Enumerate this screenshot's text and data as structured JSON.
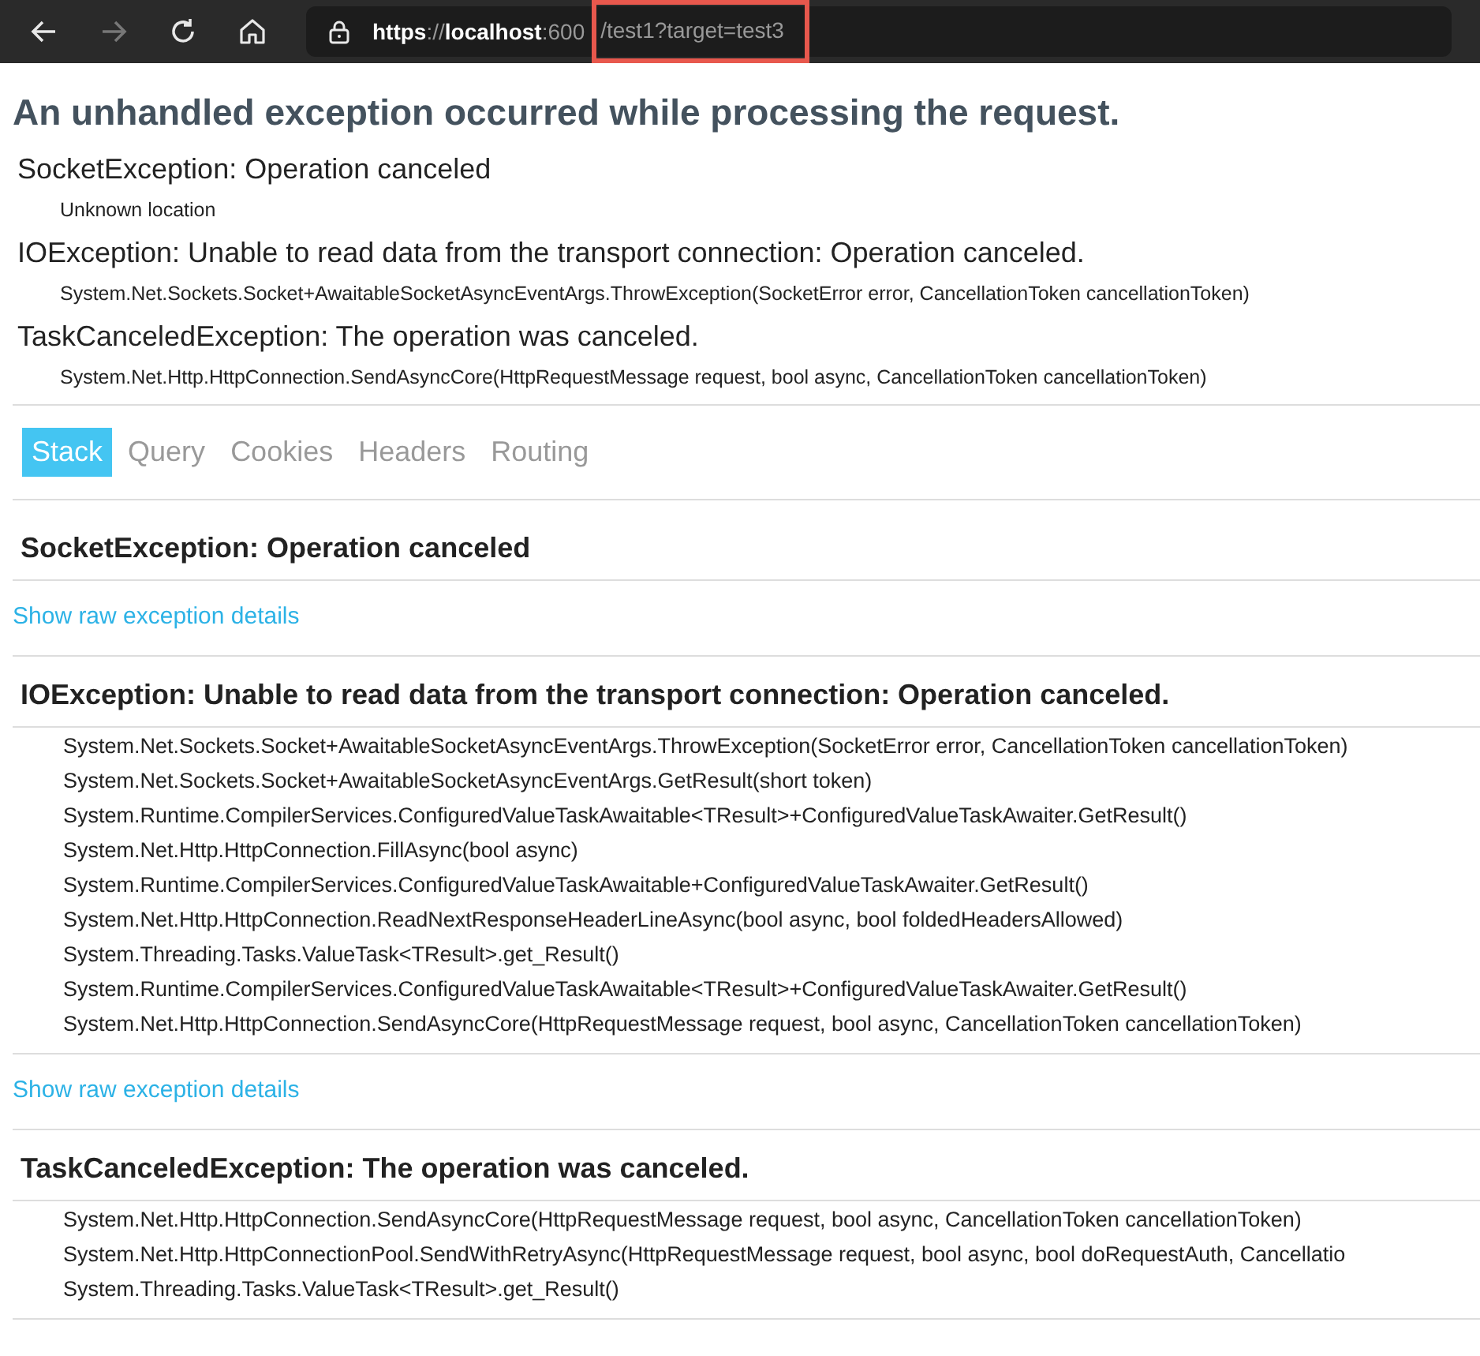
{
  "browser": {
    "url_scheme": "https",
    "url_separator": "://",
    "url_host": "localhost",
    "url_port": ":600",
    "url_path": "/test1?target=test3",
    "highlight_path": true
  },
  "title": "An unhandled exception occurred while processing the request.",
  "summary": [
    {
      "type": "SocketException: Operation canceled",
      "location": "Unknown location"
    },
    {
      "type": "IOException: Unable to read data from the transport connection: Operation canceled.",
      "location": "System.Net.Sockets.Socket+AwaitableSocketAsyncEventArgs.ThrowException(SocketError error, CancellationToken cancellationToken)"
    },
    {
      "type": "TaskCanceledException: The operation was canceled.",
      "location": "System.Net.Http.HttpConnection.SendAsyncCore(HttpRequestMessage request, bool async, CancellationToken cancellationToken)"
    }
  ],
  "tabs": [
    {
      "label": "Stack",
      "selected": true
    },
    {
      "label": "Query",
      "selected": false
    },
    {
      "label": "Cookies",
      "selected": false
    },
    {
      "label": "Headers",
      "selected": false
    },
    {
      "label": "Routing",
      "selected": false
    }
  ],
  "stack": [
    {
      "heading": "SocketException: Operation canceled",
      "link": "Show raw exception details"
    },
    {
      "heading": "IOException: Unable to read data from the transport connection: Operation canceled.",
      "frames": [
        "System.Net.Sockets.Socket+AwaitableSocketAsyncEventArgs.ThrowException(SocketError error, CancellationToken cancellationToken)",
        "System.Net.Sockets.Socket+AwaitableSocketAsyncEventArgs.GetResult(short token)",
        "System.Runtime.CompilerServices.ConfiguredValueTaskAwaitable<TResult>+ConfiguredValueTaskAwaiter.GetResult()",
        "System.Net.Http.HttpConnection.FillAsync(bool async)",
        "System.Runtime.CompilerServices.ConfiguredValueTaskAwaitable+ConfiguredValueTaskAwaiter.GetResult()",
        "System.Net.Http.HttpConnection.ReadNextResponseHeaderLineAsync(bool async, bool foldedHeadersAllowed)",
        "System.Threading.Tasks.ValueTask<TResult>.get_Result()",
        "System.Runtime.CompilerServices.ConfiguredValueTaskAwaitable<TResult>+ConfiguredValueTaskAwaiter.GetResult()",
        "System.Net.Http.HttpConnection.SendAsyncCore(HttpRequestMessage request, bool async, CancellationToken cancellationToken)"
      ],
      "link": "Show raw exception details"
    },
    {
      "heading": "TaskCanceledException: The operation was canceled.",
      "frames": [
        "System.Net.Http.HttpConnection.SendAsyncCore(HttpRequestMessage request, bool async, CancellationToken cancellationToken)",
        "System.Net.Http.HttpConnectionPool.SendWithRetryAsync(HttpRequestMessage request, bool async, bool doRequestAuth, Cancellatio",
        "System.Threading.Tasks.ValueTask<TResult>.get_Result()"
      ]
    }
  ]
}
